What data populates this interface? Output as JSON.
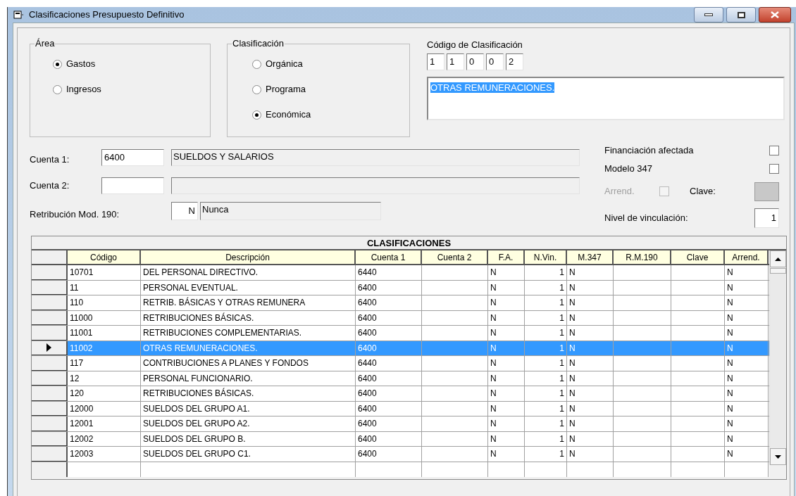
{
  "window": {
    "title": "Clasificaciones Presupuesto Definitivo"
  },
  "area": {
    "label": "Área",
    "options": [
      {
        "label": "Gastos",
        "selected": true
      },
      {
        "label": "Ingresos",
        "selected": false
      }
    ]
  },
  "clasificacion": {
    "label": "Clasificación",
    "options": [
      {
        "label": "Orgánica",
        "selected": false
      },
      {
        "label": "Programa",
        "selected": false
      },
      {
        "label": "Económica",
        "selected": true
      }
    ]
  },
  "codigo": {
    "label": "Código de Clasificación",
    "digits": [
      "1",
      "1",
      "0",
      "0",
      "2"
    ],
    "description": "OTRAS REMUNERACIONES."
  },
  "cuenta_1": {
    "label": "Cuenta 1:",
    "value": "6400",
    "description": "SUELDOS Y SALARIOS"
  },
  "cuenta_2": {
    "label": "Cuenta 2:"
  },
  "retribucion": {
    "label": "Retribución Mod. 190:",
    "code": "N",
    "description": "Nunca"
  },
  "financiacion_afectada": {
    "label": "Financiación afectada",
    "checked": false
  },
  "modelo_347": {
    "label": "Modelo 347",
    "checked": false
  },
  "arrend": {
    "label": "Arrend.",
    "checked": false,
    "disabled": true
  },
  "clave": {
    "label": "Clave:"
  },
  "nivel_vinculacion": {
    "label": "Nivel de vinculación:",
    "value": "1"
  },
  "table": {
    "title": "CLASIFICACIONES",
    "columns": [
      "Código",
      "Descripción",
      "Cuenta 1",
      "Cuenta 2",
      "F.A.",
      "N.Vin.",
      "M.347",
      "R.M.190",
      "Clave",
      "Arrend."
    ],
    "rows": [
      {
        "selected": false,
        "cells": [
          "10701",
          "DEL PERSONAL DIRECTIVO.",
          "6440",
          "",
          "N",
          "1",
          "N",
          "",
          "",
          "N"
        ]
      },
      {
        "selected": false,
        "cells": [
          "11",
          "PERSONAL EVENTUAL.",
          "6400",
          "",
          "N",
          "1",
          "N",
          "",
          "",
          "N"
        ]
      },
      {
        "selected": false,
        "cells": [
          "110",
          "RETRIB. BÁSICAS Y OTRAS REMUNERA",
          "6400",
          "",
          "N",
          "1",
          "N",
          "",
          "",
          "N"
        ]
      },
      {
        "selected": false,
        "cells": [
          "11000",
          "RETRIBUCIONES BÁSICAS.",
          "6400",
          "",
          "N",
          "1",
          "N",
          "",
          "",
          "N"
        ]
      },
      {
        "selected": false,
        "cells": [
          "11001",
          "RETRIBUCIONES COMPLEMENTARIAS.",
          "6400",
          "",
          "N",
          "1",
          "N",
          "",
          "",
          "N"
        ]
      },
      {
        "selected": true,
        "cells": [
          "11002",
          "OTRAS REMUNERACIONES.",
          "6400",
          "",
          "N",
          "1",
          "N",
          "",
          "",
          "N"
        ]
      },
      {
        "selected": false,
        "cells": [
          "117",
          "CONTRIBUCIONES A PLANES Y FONDOS",
          "6440",
          "",
          "N",
          "1",
          "N",
          "",
          "",
          "N"
        ]
      },
      {
        "selected": false,
        "cells": [
          "12",
          "PERSONAL FUNCIONARIO.",
          "6400",
          "",
          "N",
          "1",
          "N",
          "",
          "",
          "N"
        ]
      },
      {
        "selected": false,
        "cells": [
          "120",
          "RETRIBUCIONES BÁSICAS.",
          "6400",
          "",
          "N",
          "1",
          "N",
          "",
          "",
          "N"
        ]
      },
      {
        "selected": false,
        "cells": [
          "12000",
          "SUELDOS DEL GRUPO A1.",
          "6400",
          "",
          "N",
          "1",
          "N",
          "",
          "",
          "N"
        ]
      },
      {
        "selected": false,
        "cells": [
          "12001",
          "SUELDOS DEL GRUPO A2.",
          "6400",
          "",
          "N",
          "1",
          "N",
          "",
          "",
          "N"
        ]
      },
      {
        "selected": false,
        "cells": [
          "12002",
          "SUELDOS DEL GRUPO B.",
          "6400",
          "",
          "N",
          "1",
          "N",
          "",
          "",
          "N"
        ]
      },
      {
        "selected": false,
        "cells": [
          "12003",
          "SUELDOS DEL GRUPO C1.",
          "6400",
          "",
          "N",
          "1",
          "N",
          "",
          "",
          "N"
        ]
      }
    ]
  }
}
